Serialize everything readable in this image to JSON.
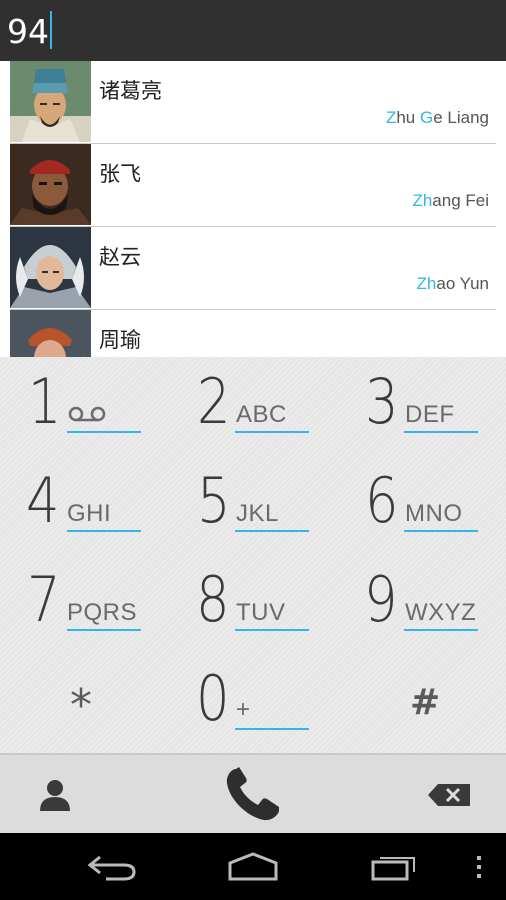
{
  "entry": {
    "digits": "94"
  },
  "contacts": [
    {
      "name": "诸葛亮",
      "pinyin_hl1": "Z",
      "pinyin_n1": "hu ",
      "pinyin_hl2": "G",
      "pinyin_n2": "e Liang"
    },
    {
      "name": "张飞",
      "pinyin_hl1": "Zh",
      "pinyin_n1": "ang Fei",
      "pinyin_hl2": "",
      "pinyin_n2": ""
    },
    {
      "name": "赵云",
      "pinyin_hl1": "Zh",
      "pinyin_n1": "ao Yun",
      "pinyin_hl2": "",
      "pinyin_n2": ""
    },
    {
      "name": "周瑜",
      "pinyin_hl1": "",
      "pinyin_n1": "",
      "pinyin_hl2": "",
      "pinyin_n2": ""
    }
  ],
  "keypad": {
    "k1": {
      "digit": "1",
      "letters": ""
    },
    "k2": {
      "digit": "2",
      "letters": "ABC"
    },
    "k3": {
      "digit": "3",
      "letters": "DEF"
    },
    "k4": {
      "digit": "4",
      "letters": "GHI"
    },
    "k5": {
      "digit": "5",
      "letters": "JKL"
    },
    "k6": {
      "digit": "6",
      "letters": "MNO"
    },
    "k7": {
      "digit": "7",
      "letters": "PQRS"
    },
    "k8": {
      "digit": "8",
      "letters": "TUV"
    },
    "k9": {
      "digit": "9",
      "letters": "WXYZ"
    },
    "kstar": {
      "digit": "*"
    },
    "k0": {
      "digit": "0",
      "letters": "+"
    },
    "khash": {
      "digit": "#"
    }
  },
  "icons": {
    "voicemail": "voicemail-icon",
    "contacts": "person-icon",
    "call": "phone-icon",
    "backspace": "backspace-icon",
    "back": "back-icon",
    "home": "home-icon",
    "recents": "recent-apps-icon",
    "menu": "overflow-menu-icon"
  },
  "colors": {
    "accent": "#33b5e5",
    "topbar": "#303030",
    "navbar": "#000000"
  }
}
